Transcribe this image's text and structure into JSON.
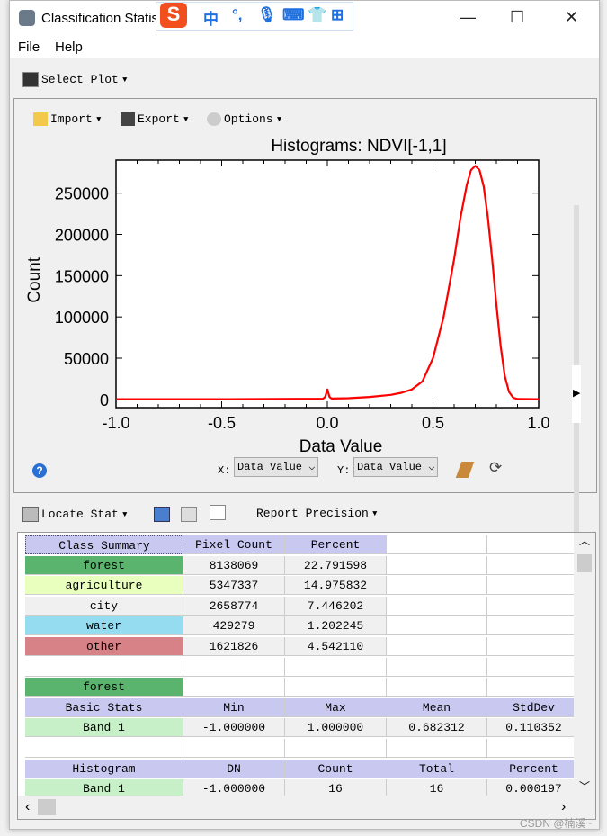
{
  "window": {
    "title": "Classification Statis",
    "controls": {
      "minimize": "—",
      "maximize": "☐",
      "close": "✕"
    }
  },
  "ime_toolbar": {
    "logo": "S",
    "items": [
      "中",
      "°,",
      "🎙",
      "⌨",
      "👕",
      "⊞"
    ]
  },
  "menu": [
    "File",
    "Help"
  ],
  "toolbar": {
    "select_plot": "Select Plot"
  },
  "plot_toolbar": {
    "import": "Import",
    "export": "Export",
    "options": "Options"
  },
  "chart_data": {
    "type": "line",
    "title": "Histograms: NDVI[-1,1]",
    "xlabel": "Data Value",
    "ylabel": "Count",
    "xlim": [
      -1,
      1
    ],
    "ylim": [
      -10000,
      290000
    ],
    "xticks": [
      "-1.0",
      "-0.5",
      "0.0",
      "0.5",
      "1.0"
    ],
    "yticks": [
      "0",
      "50000",
      "100000",
      "150000",
      "200000",
      "250000"
    ],
    "series": [
      {
        "color": "#ff0000",
        "x": [
          -1,
          -0.5,
          -0.02,
          -0.01,
          0,
          0.01,
          0.02,
          0.1,
          0.2,
          0.3,
          0.35,
          0.4,
          0.45,
          0.5,
          0.55,
          0.6,
          0.63,
          0.66,
          0.68,
          0.7,
          0.72,
          0.74,
          0.76,
          0.78,
          0.8,
          0.82,
          0.84,
          0.86,
          0.88,
          0.9,
          1
        ],
        "y": [
          200,
          300,
          800,
          3000,
          12000,
          3000,
          1000,
          1500,
          3000,
          5500,
          8000,
          12000,
          22000,
          50000,
          100000,
          170000,
          220000,
          260000,
          278000,
          283000,
          278000,
          258000,
          220000,
          170000,
          115000,
          65000,
          28000,
          9000,
          2000,
          500,
          200
        ]
      }
    ]
  },
  "axis_selectors": {
    "x_label": "X:",
    "x_value": "Data Value",
    "y_label": "Y:",
    "y_value": "Data Value"
  },
  "stats_toolbar": {
    "locate_stat": "Locate Stat",
    "report_precision": "Report Precision"
  },
  "table": {
    "rows": [
      {
        "cells": [
          "Class Summary",
          "Pixel Count",
          "Percent",
          "",
          ""
        ],
        "style": [
          "hdr",
          "hdr",
          "hdr",
          "",
          ""
        ]
      },
      {
        "cells": [
          "forest",
          "8138069",
          "22.791598",
          "",
          ""
        ],
        "label_color": "#5ab46e"
      },
      {
        "cells": [
          "agriculture",
          "5347337",
          "14.975832",
          "",
          ""
        ],
        "label_color": "#e8ffbe"
      },
      {
        "cells": [
          "city",
          "2658774",
          "7.446202",
          "",
          ""
        ],
        "label_color": "#f0f0f0"
      },
      {
        "cells": [
          "water",
          "429279",
          "1.202245",
          "",
          ""
        ],
        "label_color": "#96dcf0"
      },
      {
        "cells": [
          "other",
          "1621826",
          "4.542110",
          "",
          ""
        ],
        "label_color": "#d78287"
      },
      {
        "cells": [
          "",
          "",
          "",
          "",
          ""
        ],
        "blank": true
      },
      {
        "cells": [
          "forest",
          "",
          "",
          "",
          ""
        ],
        "label_color": "#5ab46e",
        "blank": true
      },
      {
        "cells": [
          "Basic Stats",
          "Min",
          "Max",
          "Mean",
          "StdDev"
        ],
        "header": true
      },
      {
        "cells": [
          "Band 1",
          "-1.000000",
          "1.000000",
          "0.682312",
          "0.110352"
        ],
        "label_color": "#c8f0c8"
      },
      {
        "cells": [
          "",
          "",
          "",
          "",
          ""
        ],
        "blank": true
      },
      {
        "cells": [
          "Histogram",
          "DN",
          "Count",
          "Total",
          "Percent"
        ],
        "header": true
      },
      {
        "cells": [
          "Band 1",
          "-1.000000",
          "16",
          "16",
          "0.000197"
        ],
        "label_color": "#c8f0c8"
      }
    ]
  },
  "watermark": "CSDN @楠溪~"
}
